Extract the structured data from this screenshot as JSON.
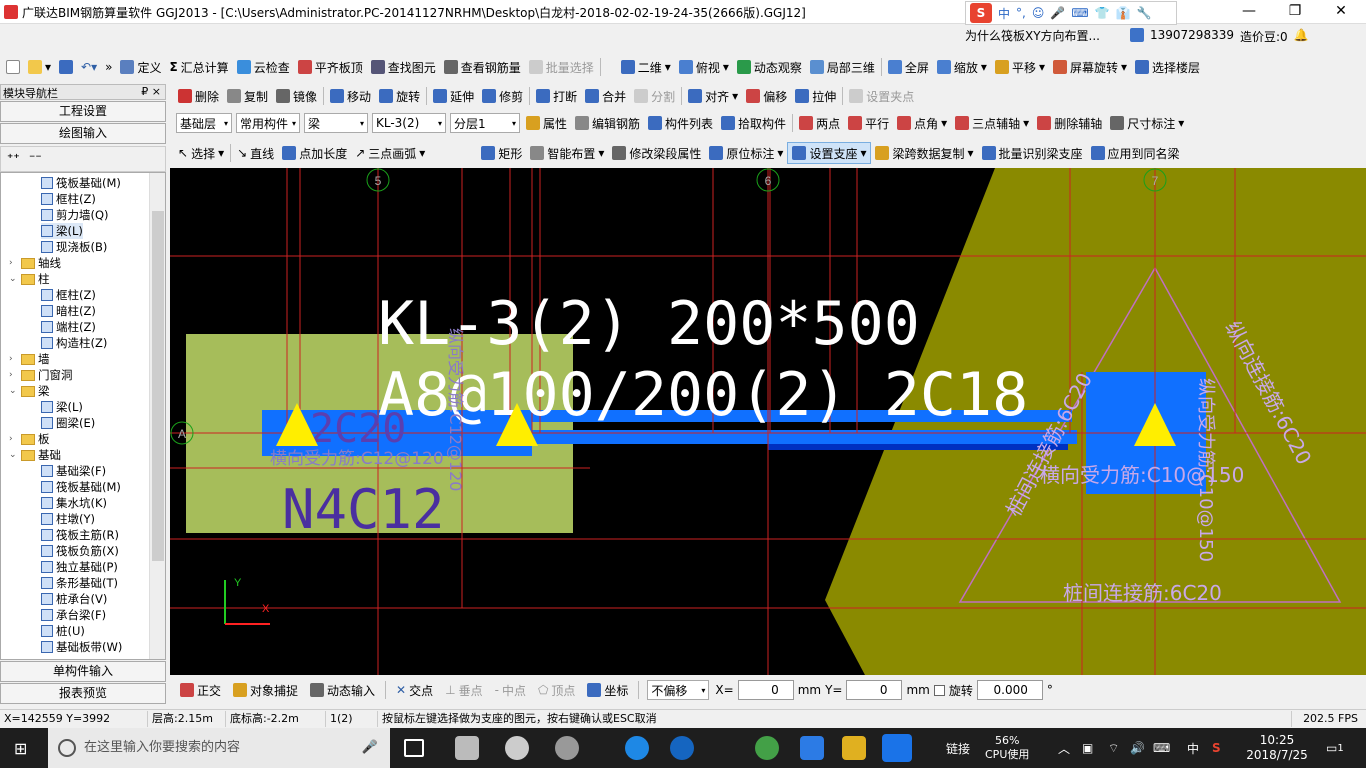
{
  "window": {
    "title": "广联达BIM钢筋算量软件 GGJ2013 - [C:\\Users\\Administrator.PC-20141127NRHM\\Desktop\\白龙村-2018-02-02-19-24-35(2666版).GGJ12]"
  },
  "ime": {
    "items": [
      "中",
      "°,",
      "☺",
      "🎤",
      "⌨",
      "👕",
      "👔",
      "🔧"
    ]
  },
  "notice": "为什么筏板XY方向布置...",
  "account": {
    "phone": "13907298339",
    "bean": "造价豆:0"
  },
  "toolbar1": [
    "定义",
    "汇总计算",
    "云检查",
    "平齐板顶",
    "查找图元",
    "查看钢筋量",
    "批量选择",
    "二维",
    "俯视",
    "动态观察",
    "局部三维",
    "全屏",
    "缩放",
    "平移",
    "屏幕旋转",
    "选择楼层"
  ],
  "toolbar2": [
    "删除",
    "复制",
    "镜像",
    "移动",
    "旋转",
    "延伸",
    "修剪",
    "打断",
    "合并",
    "分割",
    "对齐",
    "偏移",
    "拉伸",
    "设置夹点"
  ],
  "toolbar3": {
    "combos": [
      "基础层",
      "常用构件",
      "梁",
      "KL-3(2)",
      "分层1"
    ],
    "items": [
      "属性",
      "编辑钢筋",
      "构件列表",
      "拾取构件",
      "两点",
      "平行",
      "点角",
      "三点辅轴",
      "删除辅轴",
      "尺寸标注"
    ]
  },
  "toolbar4": [
    "选择",
    "直线",
    "点加长度",
    "三点画弧",
    "矩形",
    "智能布置",
    "修改梁段属性",
    "原位标注",
    "设置支座",
    "梁跨数据复制",
    "批量识别梁支座",
    "应用到同名梁"
  ],
  "nav": {
    "title": "模块导航栏",
    "pin": "₽ ×",
    "btn_project": "工程设置",
    "btn_draw": "绘图输入",
    "btn_single": "单构件输入",
    "btn_report": "报表预览"
  },
  "tree": [
    {
      "label": "筏板基础(M)",
      "kind": "item",
      "level": 2
    },
    {
      "label": "框柱(Z)",
      "kind": "item",
      "level": 2
    },
    {
      "label": "剪力墙(Q)",
      "kind": "item",
      "level": 2
    },
    {
      "label": "梁(L)",
      "kind": "item",
      "level": 2
    },
    {
      "label": "现浇板(B)",
      "kind": "item",
      "level": 2
    },
    {
      "label": "轴线",
      "kind": "folder",
      "level": 1,
      "ex": ">"
    },
    {
      "label": "柱",
      "kind": "folder",
      "level": 1,
      "ex": "v"
    },
    {
      "label": "框柱(Z)",
      "kind": "item",
      "level": 2
    },
    {
      "label": "暗柱(Z)",
      "kind": "item",
      "level": 2
    },
    {
      "label": "端柱(Z)",
      "kind": "item",
      "level": 2
    },
    {
      "label": "构造柱(Z)",
      "kind": "item",
      "level": 2
    },
    {
      "label": "墙",
      "kind": "folder",
      "level": 1,
      "ex": ">"
    },
    {
      "label": "门窗洞",
      "kind": "folder",
      "level": 1,
      "ex": ">"
    },
    {
      "label": "梁",
      "kind": "folder",
      "level": 1,
      "ex": "v"
    },
    {
      "label": "梁(L)",
      "kind": "item",
      "level": 2
    },
    {
      "label": "圈梁(E)",
      "kind": "item",
      "level": 2
    },
    {
      "label": "板",
      "kind": "folder",
      "level": 1,
      "ex": ">"
    },
    {
      "label": "基础",
      "kind": "folder",
      "level": 1,
      "ex": "v"
    },
    {
      "label": "基础梁(F)",
      "kind": "item",
      "level": 2
    },
    {
      "label": "筏板基础(M)",
      "kind": "item",
      "level": 2
    },
    {
      "label": "集水坑(K)",
      "kind": "item",
      "level": 2
    },
    {
      "label": "柱墩(Y)",
      "kind": "item",
      "level": 2
    },
    {
      "label": "筏板主筋(R)",
      "kind": "item",
      "level": 2
    },
    {
      "label": "筏板负筋(X)",
      "kind": "item",
      "level": 2
    },
    {
      "label": "独立基础(P)",
      "kind": "item",
      "level": 2
    },
    {
      "label": "条形基础(T)",
      "kind": "item",
      "level": 2
    },
    {
      "label": "桩承台(V)",
      "kind": "item",
      "level": 2
    },
    {
      "label": "承台梁(F)",
      "kind": "item",
      "level": 2
    },
    {
      "label": "桩(U)",
      "kind": "item",
      "level": 2
    },
    {
      "label": "基础板带(W)",
      "kind": "item",
      "level": 2
    }
  ],
  "canvas": {
    "axes": [
      "5",
      "6",
      "7",
      "A"
    ],
    "beam_name": "KL-3(2) 200*500",
    "beam_stirrup": "A8@100/200(2) 2C18",
    "left_rebar1": "2C20",
    "left_rebar2": "横向受力筋:C12@120",
    "left_rebar3": "N4C12",
    "left_vertical": "纵向受力筋:C12@120",
    "right_h_rebar": "横向受力筋:C10@150",
    "right_v_rebar": "纵向受力筋:C10@150",
    "pile_conn_bottom": "桩间连接筋:6C20",
    "pile_conn_left": "桩间连接筋:6C20",
    "pile_conn_right": "纵向连接筋:6C20",
    "ucs_y": "Y",
    "ucs_x": "X"
  },
  "snapbar": {
    "items": [
      "正交",
      "对象捕捉",
      "动态输入",
      "交点",
      "垂点",
      "中点",
      "顶点",
      "坐标"
    ],
    "offset": "不偏移",
    "x_label": "X=",
    "x_value": "0",
    "y_label": "Y=",
    "y_value": "0",
    "unit": "mm",
    "rotate_label": "旋转",
    "rotate_value": "0.000",
    "deg": "°"
  },
  "status": {
    "coords": "X=142559 Y=3992",
    "floor_h": "层高:2.15m",
    "bottom_h": "底标高:-2.2m",
    "span": "1(2)",
    "hint": "按鼠标左键选择做为支座的图元，按右键确认或ESC取消",
    "fps": "202.5 FPS"
  },
  "taskbar": {
    "search": "在这里输入你要搜索的内容",
    "link": "链接",
    "cpu_pct": "56%",
    "cpu_label": "CPU使用",
    "ime": "中",
    "time": "10:25",
    "date": "2018/7/25",
    "notif": "1"
  }
}
